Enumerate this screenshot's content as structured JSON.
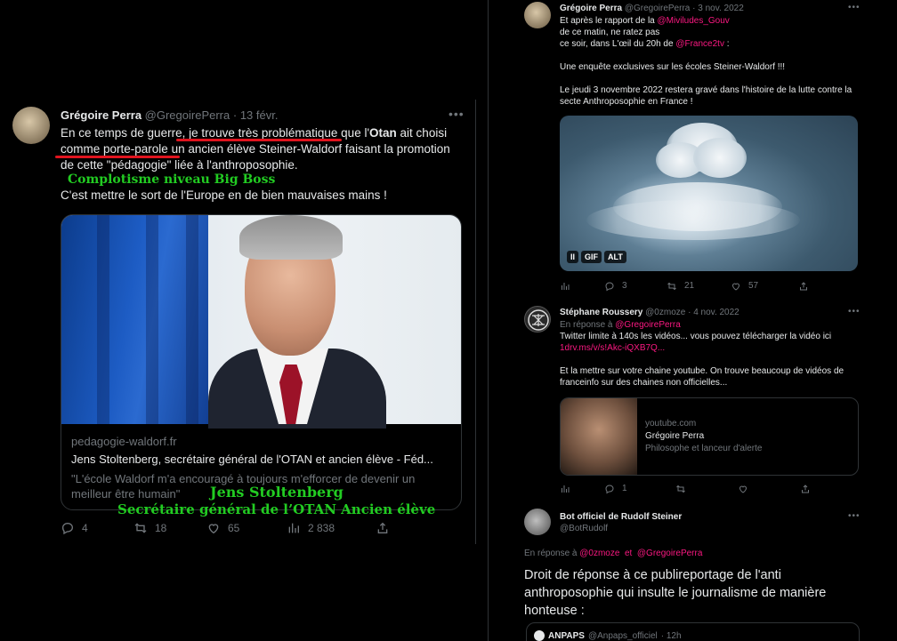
{
  "left_tweet": {
    "author_name": "Grégoire Perra",
    "author_handle": "@GregoirePerra",
    "date": "· 13 févr.",
    "text_plain_1": "En ce temps de guerre, ",
    "text_underlined_1": "je trouve très problématique",
    "text_plain_2": " que l'",
    "text_bold_1": "Otan",
    "text_plain_3": " ait choisi",
    "text_underlined_2": "comme porte-parole",
    "text_plain_4": " un ancien élève Steiner-Waldorf faisant la promotion de cette \"pédagogie\" liée à l'anthroposophie.",
    "overlay_label_1": "Complotisme niveau Big Boss",
    "text_second": "C'est mettre le sort de l'Europe en de bien mauvaises mains !",
    "card": {
      "domain": "pedagogie-waldorf.fr",
      "title": "Jens Stoltenberg, secrétaire général de l'OTAN et ancien élève - Féd...",
      "description": "\"L'école Waldorf m'a encouragé à toujours m'efforcer de devenir un meilleur être humain\""
    },
    "overlay_label_2": "Jens Stoltenberg",
    "overlay_label_3": "Secrétaire général de l’OTAN Ancien élève",
    "replies": "4",
    "retweets": "18",
    "likes": "65",
    "views": "2 838"
  },
  "right_tweet_1": {
    "author_name": "Grégoire Perra",
    "author_handle": "@GregoirePerra",
    "date": "· 3 nov. 2022",
    "line1_pre": "Et après le rapport de la ",
    "line1_mention": "@Miviludes_Gouv",
    "line2": "de ce matin, ne ratez pas",
    "line3_pre": "ce soir, dans L'œil du 20h de ",
    "line3_mention": "@France2tv",
    "line3_post": " :",
    "para2": "Une enquête exclusives sur les écoles Steiner-Waldorf !!!",
    "para3": "Le jeudi 3 novembre 2022 restera gravé dans l'histoire de la lutte contre la secte Anthroposophie en France !",
    "badges": [
      "II",
      "GIF",
      "ALT"
    ],
    "replies": "3",
    "retweets": "21",
    "likes": "57"
  },
  "right_tweet_2": {
    "author_name": "Stéphane Roussery",
    "author_handle": "@0zmoze",
    "date": "· 4 nov. 2022",
    "reply_to_label": "En réponse à ",
    "reply_to_handle": "@GregoirePerra",
    "line1": "Twitter limite à 140s les vidéos... vous pouvez télécharger la vidéo ici",
    "link": "1drv.ms/v/s!Akc-iQXB7Q...",
    "para2": "Et la mettre sur votre chaine youtube. On trouve beaucoup de vidéos de franceinfo sur des chaines non officielles...",
    "card": {
      "domain": "youtube.com",
      "title": "Grégoire Perra",
      "description": "Philosophe et lanceur d'alerte"
    },
    "replies": "1"
  },
  "right_tweet_3": {
    "author_name": "Bot officiel de Rudolf Steiner",
    "author_handle": "@BotRudolf",
    "reply_to_label": "En réponse à ",
    "reply_to_handle_1": "@0zmoze",
    "reply_to_and": "  et  ",
    "reply_to_handle_2": "@GregoirePerra",
    "text": "Droit de réponse à ce publireportage de l'anti anthroposophie qui insulte le journalisme de manière honteuse :",
    "quote_name": "ANPAPS",
    "quote_handle": "@Anpaps_officiel",
    "quote_date": "· 12h"
  },
  "icons": [
    "reply-icon",
    "retweet-icon",
    "like-icon",
    "views-icon",
    "share-icon",
    "more-icon"
  ],
  "colors": {
    "accent_link": "#f91880",
    "overlay_green": "#22cc22",
    "underline_red": "#e0141e"
  }
}
